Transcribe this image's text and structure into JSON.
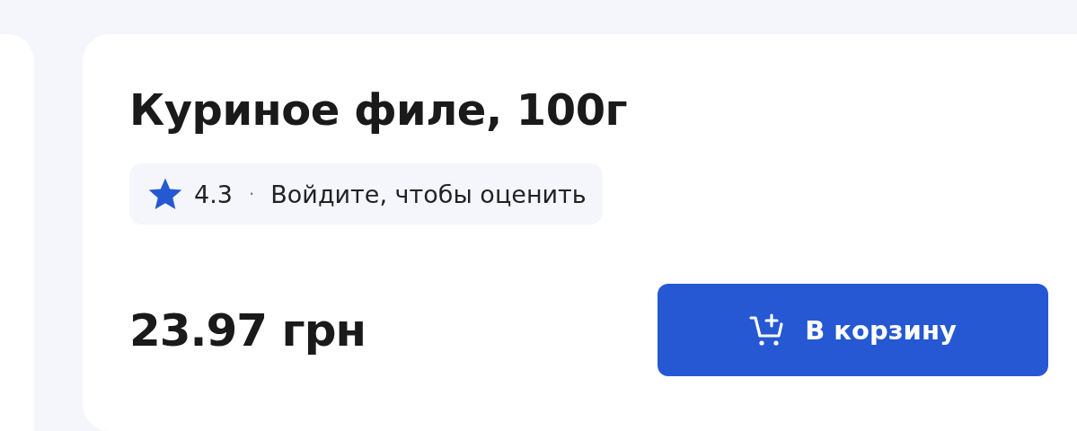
{
  "product": {
    "title": "Куриное филе, 100г",
    "rating": {
      "value": "4.3",
      "separator": "·",
      "prompt": "Войдите, чтобы оценить"
    },
    "price": "23.97 грн",
    "cart_button": {
      "label": "В корзину"
    }
  }
}
